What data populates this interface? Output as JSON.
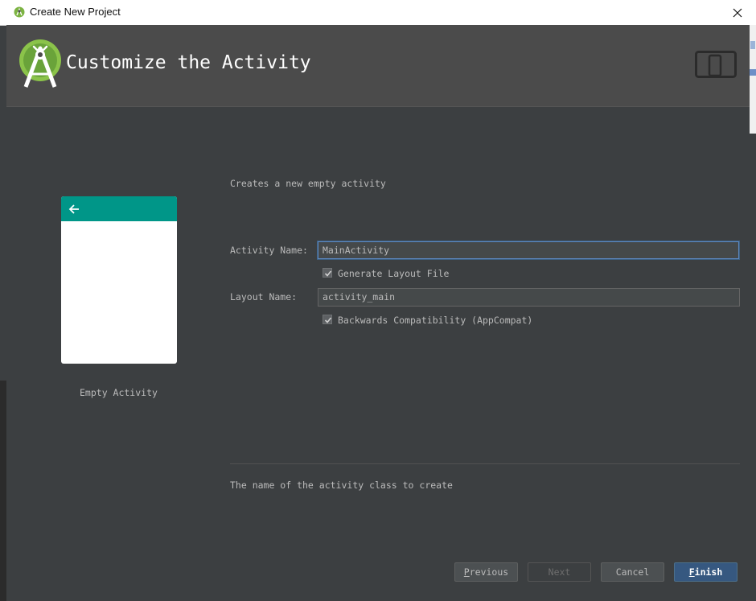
{
  "window": {
    "title": "Create New Project"
  },
  "header": {
    "title": "Customize the Activity"
  },
  "template": {
    "name": "Empty Activity"
  },
  "form": {
    "description": "Creates a new empty activity",
    "activity_name_label": "Activity Name:",
    "activity_name_value": "MainActivity",
    "generate_layout_label": "Generate Layout File",
    "generate_layout_checked": true,
    "layout_name_label": "Layout Name:",
    "layout_name_value": "activity_main",
    "backwards_compat_label": "Backwards Compatibility (AppCompat)",
    "backwards_compat_checked": true,
    "help_text": "The name of the activity class to create"
  },
  "buttons": {
    "previous_mnemonic": "P",
    "previous_rest": "revious",
    "next": "Next",
    "cancel": "Cancel",
    "finish_mnemonic": "F",
    "finish_rest": "inish"
  },
  "colors": {
    "dialog_bg": "#3c3f41",
    "header_bg": "#4b4b4b",
    "accent_teal": "#009688",
    "android_green": "#8bc34a",
    "primary_button": "#365880"
  }
}
